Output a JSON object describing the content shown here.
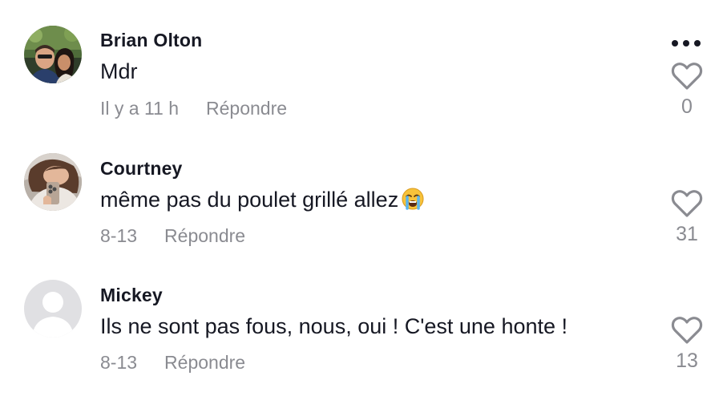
{
  "comments": [
    {
      "username": "Brian Olton",
      "text": "Mdr",
      "time": "Il y a 11 h",
      "reply_label": "Répondre",
      "likes": "0",
      "avatar": "photo-couple"
    },
    {
      "username": "Courtney",
      "text": "même pas du poulet grillé allez",
      "emoji": "😭",
      "time": "8-13",
      "reply_label": "Répondre",
      "likes": "31",
      "avatar": "photo-mirror-selfie"
    },
    {
      "username": "Mickey",
      "text": "Ils ne sont pas fous, nous, oui ! C'est une honte !",
      "time": "8-13",
      "reply_label": "Répondre",
      "likes": "13",
      "avatar": "default-avatar"
    }
  ],
  "icons": {
    "more": "more-dots-icon",
    "like": "heart-outline-icon"
  },
  "colors": {
    "text": "#161823",
    "secondary": "#8a8b91",
    "icon": "#8a8b91"
  }
}
